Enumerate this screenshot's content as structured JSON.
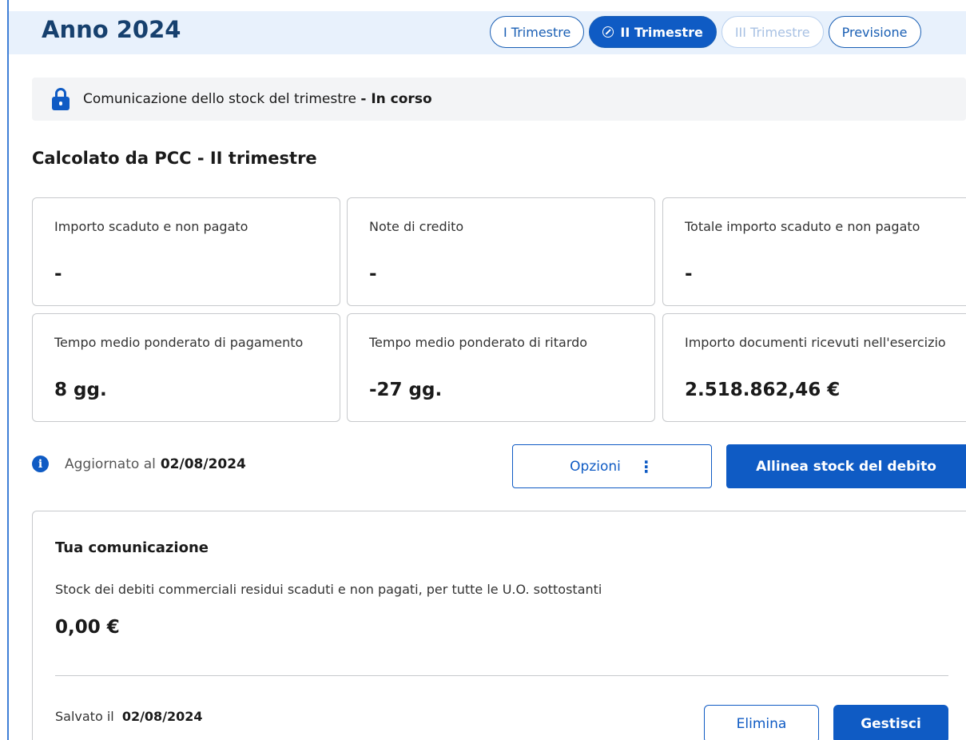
{
  "header": {
    "year_title": "Anno 2024",
    "tabs": [
      {
        "label": "I Trimestre",
        "state": "default"
      },
      {
        "label": "II Trimestre",
        "state": "active"
      },
      {
        "label": "III Trimestre",
        "state": "disabled"
      },
      {
        "label": "Previsione",
        "state": "default"
      }
    ]
  },
  "status": {
    "icon": "lock-icon",
    "text": "Comunicazione dello stock del trimestre",
    "state": "- In corso"
  },
  "section": {
    "title": "Calcolato da PCC - II trimestre"
  },
  "cards": [
    {
      "label": "Importo scaduto e non pagato",
      "value": "-"
    },
    {
      "label": "Note di credito",
      "value": "-"
    },
    {
      "label": "Totale importo scaduto e non pagato",
      "value": "-"
    },
    {
      "label": "Tempo medio ponderato di pagamento",
      "value": "8 gg."
    },
    {
      "label": "Tempo medio ponderato di ritardo",
      "value": "-27 gg."
    },
    {
      "label": "Importo documenti ricevuti nell'esercizio",
      "value": "2.518.862,46 €"
    }
  ],
  "update": {
    "icon": "info-icon",
    "prefix": "Aggiornato al",
    "date": "02/08/2024"
  },
  "actions": {
    "options_label": "Opzioni",
    "options_icon": "kebab-menu-icon",
    "align_label": "Allinea stock del debito"
  },
  "communication": {
    "title": "Tua comunicazione",
    "description": "Stock dei debiti commerciali residui scaduti e non pagati, per tutte le U.O. sottostanti",
    "amount": "0,00 €",
    "saved_prefix": "Salvato il",
    "saved_date": "02/08/2024",
    "delete_label": "Elimina",
    "manage_label": "Gestisci"
  },
  "colors": {
    "primary": "#0f5bc4",
    "header_bg": "#e8f1fc",
    "title_color": "#16406e",
    "status_bg": "#f3f4f6",
    "border": "#c7c9cc"
  }
}
